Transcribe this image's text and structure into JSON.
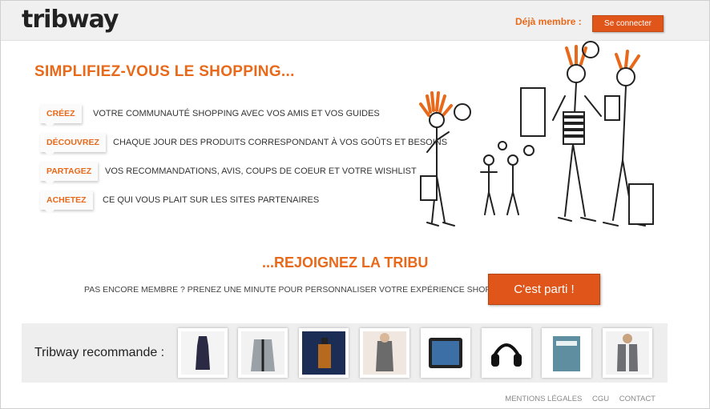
{
  "header": {
    "logo_text": "tribway",
    "member_text": "Déjà membre :",
    "connect_label": "Se connecter"
  },
  "hero": {
    "headline": "SIMPLIFIEZ-VOUS LE SHOPPING...",
    "items": [
      {
        "tag": "CRÉEZ",
        "text": "VOTRE COMMUNAUTÉ SHOPPING AVEC VOS AMIS ET VOS GUIDES"
      },
      {
        "tag": "DÉCOUVREZ",
        "text": "CHAQUE JOUR DES PRODUITS CORRESPONDANT À VOS GOÛTS ET BESOINS"
      },
      {
        "tag": "PARTAGEZ",
        "text": "VOS RECOMMANDATIONS, AVIS, COUPS DE COEUR ET VOTRE WISHLIST"
      },
      {
        "tag": "ACHETEZ",
        "text": "CE QUI VOUS PLAIT SUR LES SITES PARTENAIRES"
      }
    ]
  },
  "join": {
    "title": "...REJOIGNEZ LA TRIBU",
    "text": "PAS ENCORE MEMBRE ? PRENEZ UNE MINUTE POUR PERSONNALISER VOTRE EXPÉRIENCE SHOPPING :",
    "cta_label": "C'est parti !"
  },
  "recommend": {
    "label": "Tribway recommande :",
    "products": [
      "dress",
      "jacket",
      "perfume",
      "top",
      "tablet",
      "headphones",
      "book",
      "vest"
    ]
  },
  "footer": {
    "links": [
      "MENTIONS LÉGALES",
      "CGU",
      "CONTACT"
    ]
  },
  "colors": {
    "accent": "#e8691a",
    "button": "#e0561a"
  }
}
